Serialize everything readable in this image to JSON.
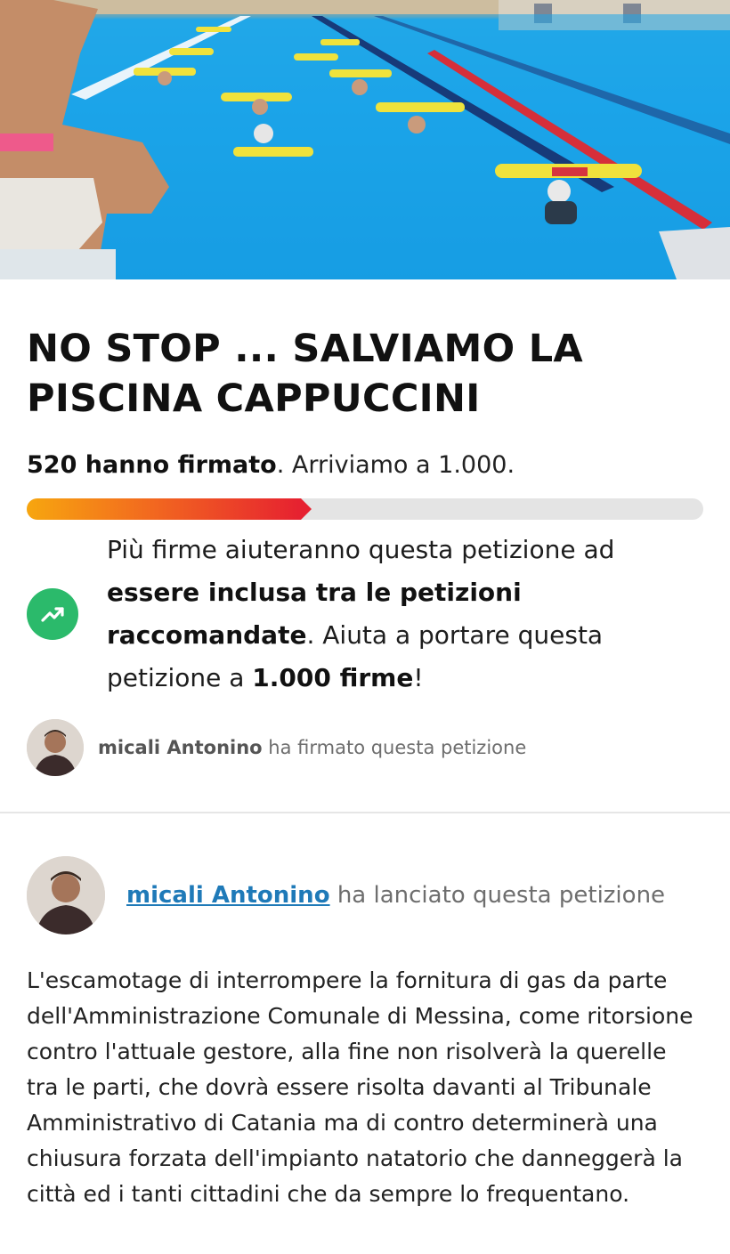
{
  "hero": {
    "alt": "Pool aqua-gym class photo"
  },
  "petition": {
    "title": "NO STOP ... SALVIAMO LA PISCINA CAPPUCCINI",
    "signed_count": "520 hanno firmato",
    "goal_text": ". Arriviamo a 1.000.",
    "progress_fraction": 0.52,
    "colors": {
      "progress_start": "#f7a60f",
      "progress_end": "#e62130",
      "promo_icon_bg": "#2bba6b",
      "link": "#1f7ab8"
    }
  },
  "promo": {
    "icon": "trending-up-icon",
    "text_1": "Più firme aiuteranno questa petizione ad ",
    "bold_1": "essere inclusa tra le petizioni raccomandate",
    "text_2": ". Aiuta a portare questa petizione a ",
    "bold_2": "1.000 firme",
    "text_3": "!"
  },
  "recent_signer": {
    "name": "micali Antonino",
    "action": " ha firmato questa petizione"
  },
  "starter": {
    "name": "micali Antonino",
    "action": " ha lanciato questa petizione"
  },
  "description": "L'escamotage di interrompere la fornitura di gas da parte dell'Amministrazione Comunale di Messina, come ritorsione contro l'attuale gestore, alla fine non risolverà la querelle tra le parti, che dovrà essere risolta davanti al Tribunale Amministrativo di Catania ma di contro determinerà una chiusura forzata dell'impianto natatorio che danneggerà la città ed i tanti cittadini che da sempre lo frequentano."
}
